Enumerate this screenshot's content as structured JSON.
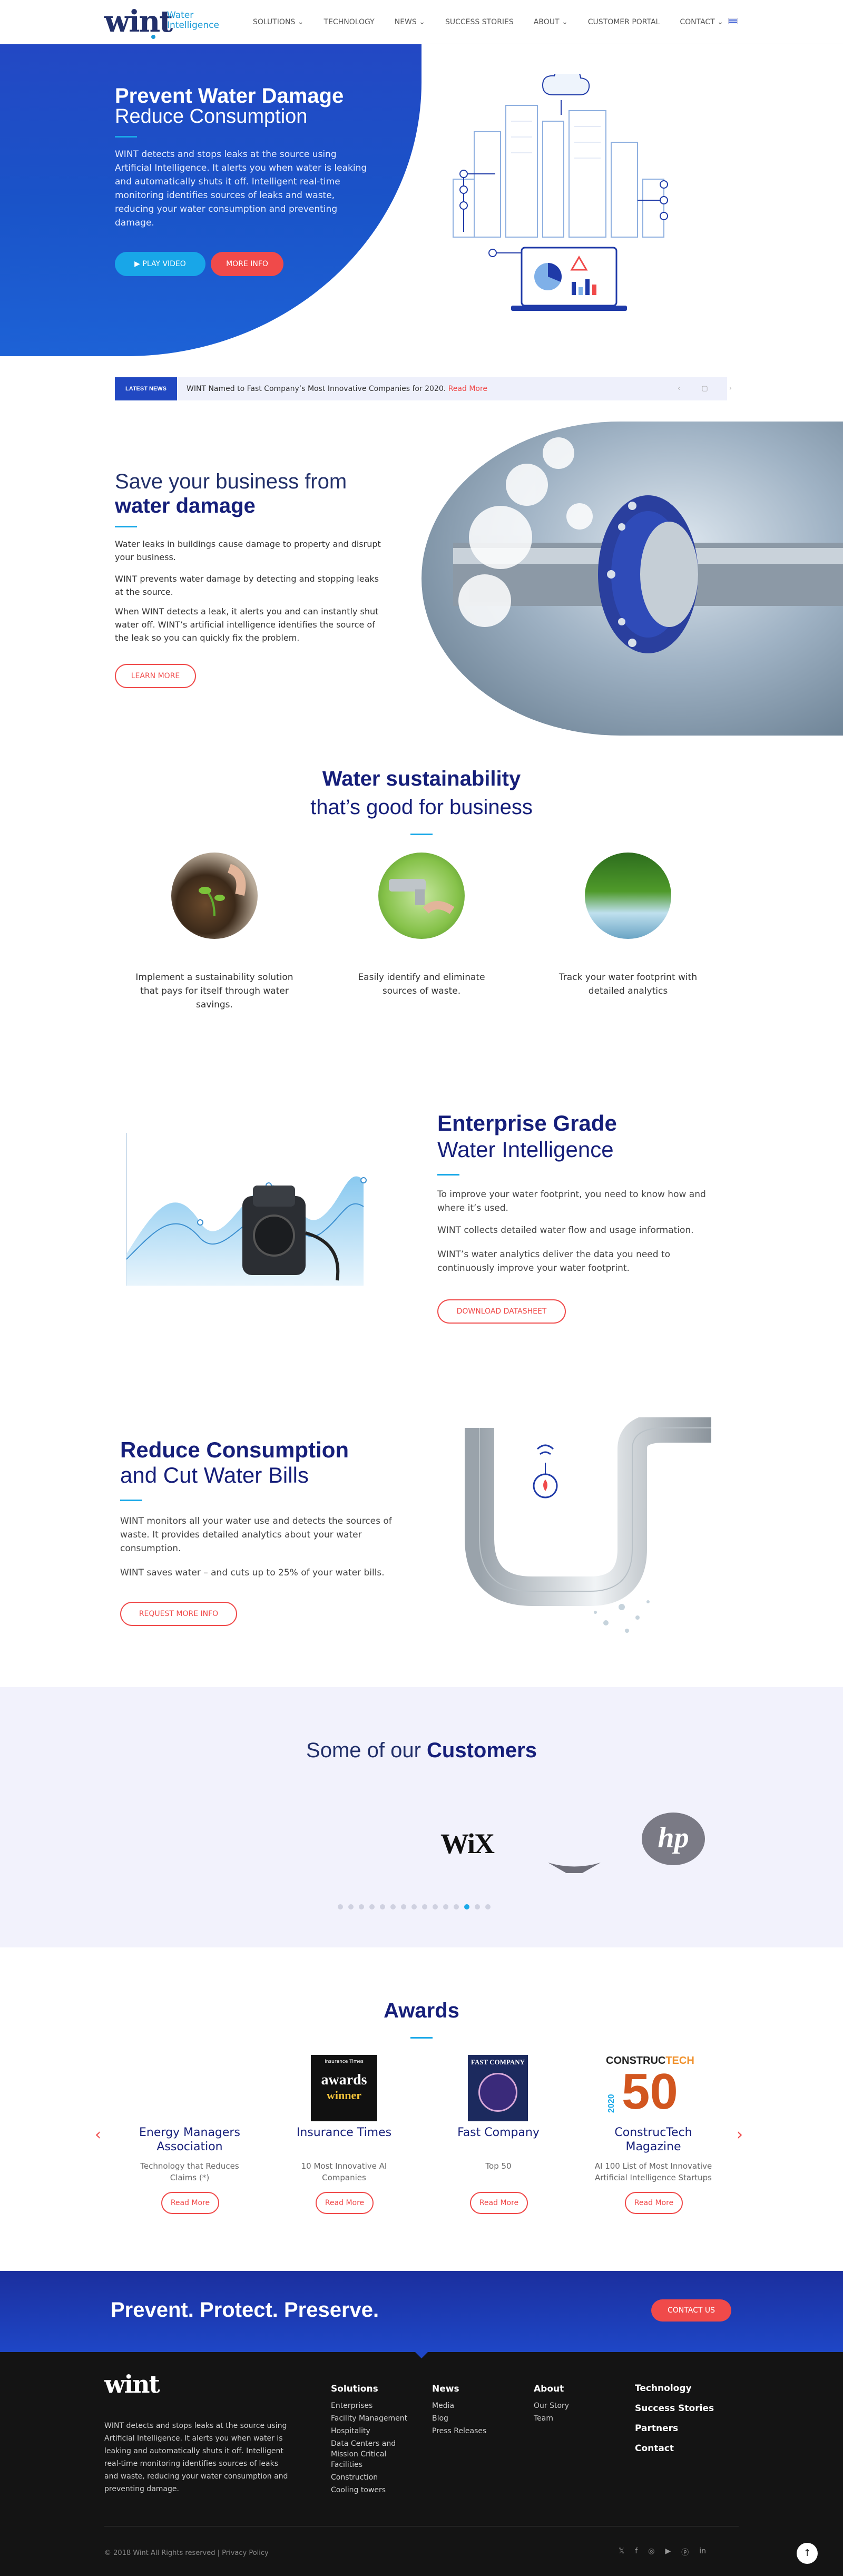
{
  "header": {
    "logo": "wint",
    "logo_sub1": "Water",
    "logo_sub2": "Intelligence",
    "nav": [
      {
        "label": "SOLUTIONS",
        "caret": "⌄"
      },
      {
        "label": "TECHNOLOGY",
        "caret": ""
      },
      {
        "label": "NEWS",
        "caret": "⌄"
      },
      {
        "label": "SUCCESS STORIES",
        "caret": ""
      },
      {
        "label": "ABOUT",
        "caret": "⌄"
      },
      {
        "label": "CUSTOMER PORTAL",
        "caret": ""
      },
      {
        "label": "CONTACT",
        "caret": "⌄"
      }
    ],
    "flag_icon": "israel-flag-icon"
  },
  "hero": {
    "title_bold": "Prevent Water Damage",
    "title_light": "Reduce Consumption",
    "body": "WINT detects and stops leaks at the source using Artificial Intelligence. It alerts you when water is leaking and automatically shuts it off. Intelligent real-time monitoring identifies sources of leaks and waste, reducing your water consumption and preventing damage.",
    "btn_play": "PLAY VIDEO",
    "btn_more": "MORE INFO",
    "colors": {
      "blue": "#2348c4",
      "accent": "#18a6e8",
      "red": "#f04a4a"
    }
  },
  "news": {
    "tag": "LATEST NEWS",
    "text": "WINT Named to Fast Company’s Most Innovative Companies for 2020.",
    "read_more": "Read More",
    "controls": "‹ ▢ ›"
  },
  "damage": {
    "title_light": "Save your business from",
    "title_bold": "water damage",
    "p1": "Water leaks in buildings cause damage to property and disrupt your business.",
    "p2": "WINT prevents water damage by detecting and stopping leaks at the source.",
    "p3": "When WINT detects a leak, it alerts you and can instantly shut water off. WINT’s artificial intelligence identifies the source of the leak so you can quickly fix the problem.",
    "btn": "LEARN MORE"
  },
  "sustain": {
    "title_bold": "Water sustainability",
    "title_light": "that’s good for business",
    "items": [
      {
        "caption": "Implement a sustainability solution that pays for itself through water savings."
      },
      {
        "caption": "Easily identify and eliminate sources of waste."
      },
      {
        "caption": "Track your water footprint with detailed analytics"
      }
    ]
  },
  "enterprise": {
    "title_bold": "Enterprise Grade",
    "title_light": "Water Intelligence",
    "p1": "To improve your water footprint, you need to know how and where it’s used.",
    "p2": "WINT collects detailed water flow and usage information.",
    "p3": "WINT’s water analytics deliver the data you need to continuously improve your water footprint.",
    "btn": "DOWNLOAD DATASHEET"
  },
  "reduce": {
    "title_bold": "Reduce Consumption",
    "title_light": "and Cut Water Bills",
    "p1": "WINT monitors all your water use and detects the sources of waste. It provides detailed analytics about your water consumption.",
    "p2": "WINT saves water – and cuts up to 25% of your water bills.",
    "btn": "REQUEST MORE INFO"
  },
  "customers": {
    "title_light": "Some of our",
    "title_bold": "Customers",
    "logos": [
      "WiX",
      "hp"
    ],
    "dots": 15,
    "active_dot": 12
  },
  "awards": {
    "title": "Awards",
    "items": [
      {
        "name": "Energy Managers Association",
        "sub": "Technology that Reduces Claims (*)",
        "btn": "Read More"
      },
      {
        "name": "Insurance Times",
        "sub": "10 Most Innovative AI Companies",
        "btn": "Read More",
        "badge_top": "Insurance Times",
        "badge_main": "awards",
        "badge_low": "winner"
      },
      {
        "name": "Fast Company",
        "sub": "Top 50",
        "btn": "Read More",
        "badge_top": "FAST COMPANY"
      },
      {
        "name": "ConstrucTech Magazine",
        "sub": "AI 100 List of Most Innovative Artificial Intelligence Startups",
        "btn": "Read More",
        "badge_top1": "CONSTRUC",
        "badge_top2": "TECH",
        "badge_year": "2020",
        "badge_num": "50"
      }
    ],
    "prev": "‹",
    "next": "›"
  },
  "cta": {
    "title": "Prevent. Protect. Preserve.",
    "btn": "CONTACT US"
  },
  "footer": {
    "logo": "wint",
    "about": "WINT detects and stops leaks at the source using Artificial Intelligence. It alerts you when water is leaking and automatically shuts it off. Intelligent real-time monitoring identifies sources of leaks and waste, reducing your water consumption and preventing damage.",
    "solutions_head": "Solutions",
    "solutions": [
      "Enterprises",
      "Facility Management",
      "Hospitality",
      "Data Centers and Mission Critical Facilities",
      "Construction",
      "Cooling towers"
    ],
    "news_head": "News",
    "news": [
      "Media",
      "Blog",
      "Press Releases"
    ],
    "about_head": "About",
    "about_links": [
      "Our Story",
      "Team"
    ],
    "big_links": [
      "Technology",
      "Success Stories",
      "Partners",
      "Contact"
    ],
    "copyright": "© 2018 Wint All Rights reserved | Privacy Policy",
    "social": [
      "twitter-icon",
      "facebook-icon",
      "instagram-icon",
      "youtube-icon",
      "pinterest-icon",
      "linkedin-icon"
    ],
    "totop": "↑"
  }
}
